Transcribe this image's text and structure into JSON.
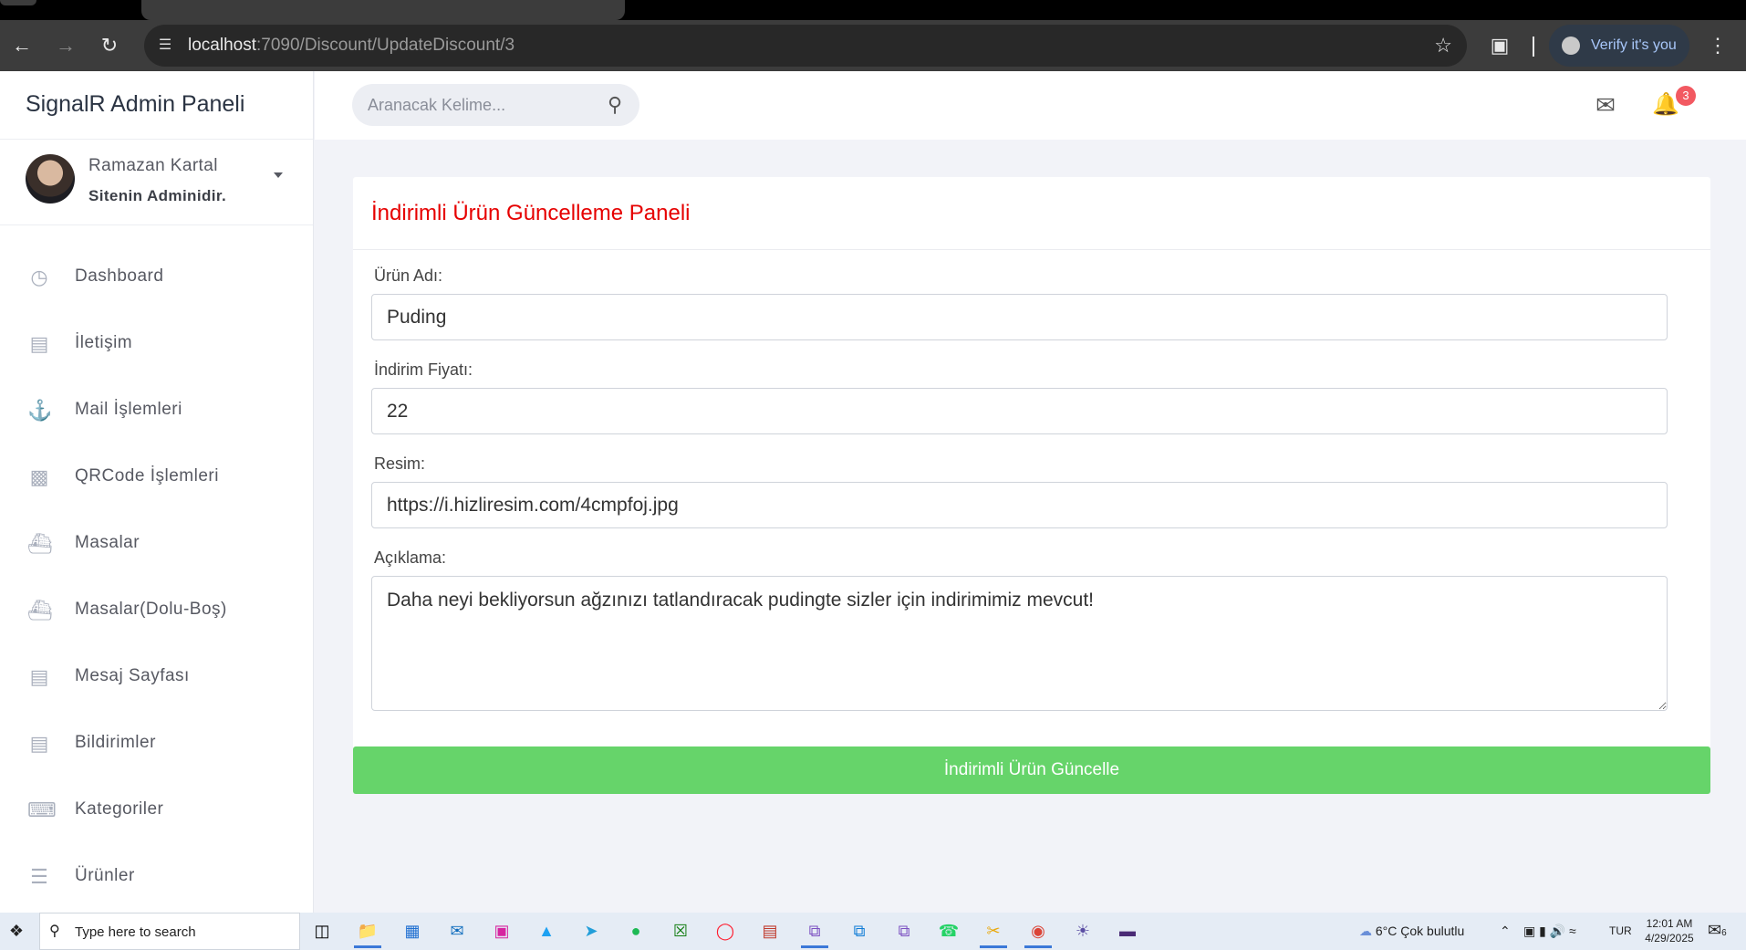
{
  "browser": {
    "url_host": "localhost",
    "url_rest": ":7090/Discount/UpdateDiscount/3",
    "profile_label": "Verify it's you"
  },
  "sidebar": {
    "brand": "SignalR Admin Paneli",
    "user_name": "Ramazan Kartal",
    "user_role": "Sitenin Adminidir.",
    "items": [
      {
        "label": "Dashboard",
        "icon": "dashboard-icon"
      },
      {
        "label": "İletişim",
        "icon": "document-icon"
      },
      {
        "label": "Mail İşlemleri",
        "icon": "anchor-icon"
      },
      {
        "label": "QRCode İşlemleri",
        "icon": "qrcode-icon"
      },
      {
        "label": "Masalar",
        "icon": "ship-icon"
      },
      {
        "label": "Masalar(Dolu-Boş)",
        "icon": "ship-icon"
      },
      {
        "label": "Mesaj Sayfası",
        "icon": "document-icon"
      },
      {
        "label": "Bildirimler",
        "icon": "document-icon"
      },
      {
        "label": "Kategoriler",
        "icon": "keyboard-icon"
      },
      {
        "label": "Ürünler",
        "icon": "cake-icon"
      }
    ]
  },
  "topbar": {
    "search_placeholder": "Aranacak Kelime...",
    "notification_count": "3"
  },
  "form": {
    "title": "İndirimli Ürün Güncelleme Paneli",
    "name_label": "Ürün Adı:",
    "name_value": "Puding",
    "price_label": "İndirim Fiyatı:",
    "price_value": "22",
    "image_label": "Resim:",
    "image_value": "https://i.hizliresim.com/4cmpfoj.jpg",
    "description_label": "Açıklama:",
    "description_value": "Daha neyi bekliyorsun ağzınızı tatlandıracak pudingte sizler için indirimimiz mevcut!",
    "submit_label": "İndirimli Ürün Güncelle"
  },
  "taskbar": {
    "search_text": "Type here to search",
    "weather": "6°C  Çok bulutlu",
    "language": "TUR",
    "time": "12:01 AM",
    "date": "4/29/2025",
    "notification_count": "6"
  }
}
